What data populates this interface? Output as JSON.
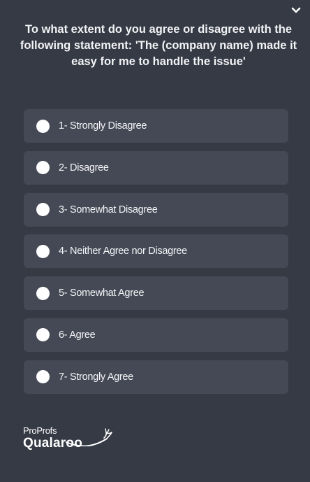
{
  "widget": {
    "question": "To what extent do you agree or disagree with the following statement: 'The (company name) made it easy for me to handle the issue'",
    "collapse_icon": "chevron-down-icon",
    "options": [
      {
        "label": "1- Strongly Disagree"
      },
      {
        "label": "2- Disagree"
      },
      {
        "label": "3- Somewhat Disagree"
      },
      {
        "label": "4- Neither Agree nor Disagree"
      },
      {
        "label": "5- Somewhat Agree"
      },
      {
        "label": "6- Agree"
      },
      {
        "label": "7- Strongly Agree"
      }
    ]
  },
  "branding": {
    "line1": "ProProfs",
    "line2": "Qualaroo"
  },
  "colors": {
    "background": "#363a45",
    "option_background": "#454955",
    "radio": "#ffffff",
    "text": "#ffffff"
  }
}
